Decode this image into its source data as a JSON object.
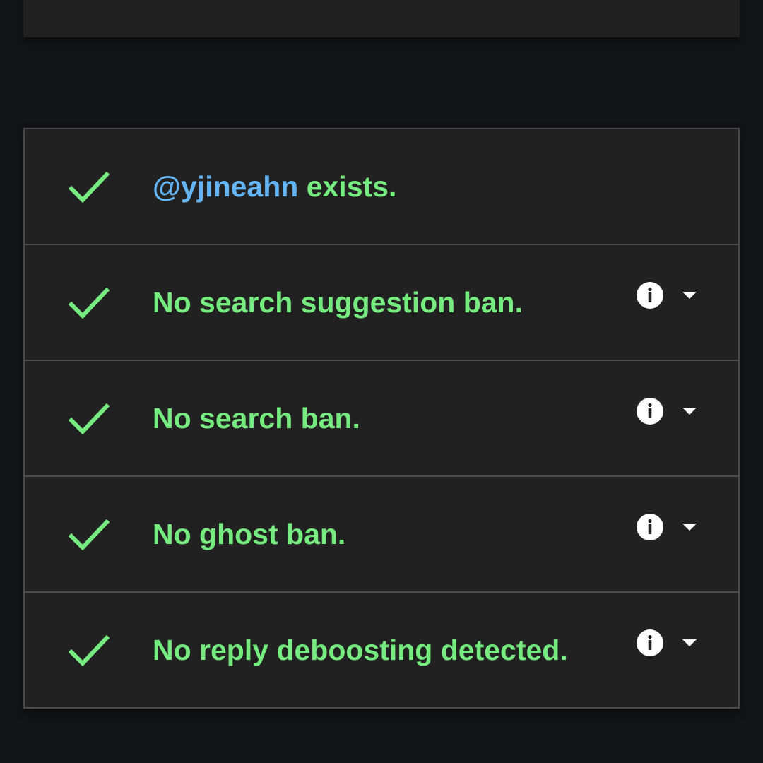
{
  "colors": {
    "background": "#111418",
    "card": "#212121",
    "border": "#4a4a4a",
    "success": "#76eb7f",
    "handle": "#64b5f6",
    "icon": "#ffffff"
  },
  "results": [
    {
      "status_icon": "check-icon",
      "handle": "@yjineahn",
      "text": " exists.",
      "has_details": false
    },
    {
      "status_icon": "check-icon",
      "text": "No search suggestion ban.",
      "has_details": true,
      "info_icon": "info-icon",
      "expand_icon": "caret-down-icon"
    },
    {
      "status_icon": "check-icon",
      "text": "No search ban.",
      "has_details": true,
      "info_icon": "info-icon",
      "expand_icon": "caret-down-icon"
    },
    {
      "status_icon": "check-icon",
      "text": "No ghost ban.",
      "has_details": true,
      "info_icon": "info-icon",
      "expand_icon": "caret-down-icon"
    },
    {
      "status_icon": "check-icon",
      "text": "No reply deboosting detected.",
      "has_details": true,
      "info_icon": "info-icon",
      "expand_icon": "caret-down-icon"
    }
  ]
}
